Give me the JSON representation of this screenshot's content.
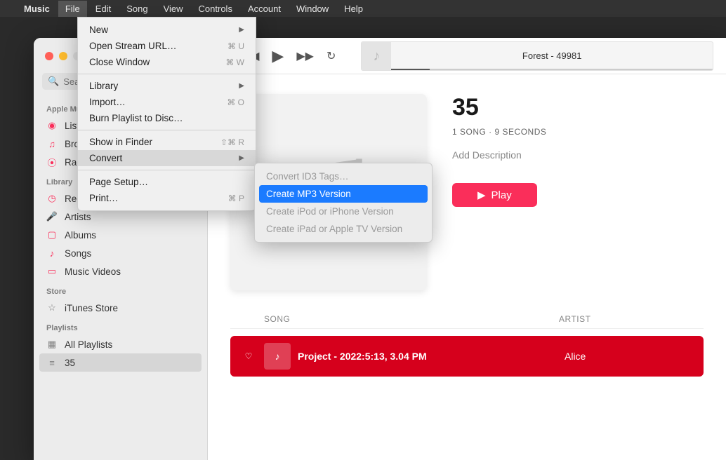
{
  "menubar": {
    "app": "Music",
    "items": [
      "File",
      "Edit",
      "Song",
      "View",
      "Controls",
      "Account",
      "Window",
      "Help"
    ],
    "active": "File"
  },
  "file_menu": {
    "items": [
      {
        "label": "New",
        "arrow": true
      },
      {
        "label": "Open Stream URL…",
        "shortcut": "⌘ U"
      },
      {
        "label": "Close Window",
        "shortcut": "⌘ W"
      },
      {
        "sep": true
      },
      {
        "label": "Library",
        "arrow": true
      },
      {
        "label": "Import…",
        "shortcut": "⌘ O"
      },
      {
        "label": "Burn Playlist to Disc…"
      },
      {
        "sep": true
      },
      {
        "label": "Show in Finder",
        "shortcut": "⇧⌘ R"
      },
      {
        "label": "Convert",
        "arrow": true,
        "hover": true
      },
      {
        "sep": true
      },
      {
        "label": "Page Setup…"
      },
      {
        "label": "Print…",
        "shortcut": "⌘ P"
      }
    ]
  },
  "convert_submenu": {
    "items": [
      {
        "label": "Convert ID3 Tags…",
        "enabled": false
      },
      {
        "label": "Create MP3 Version",
        "enabled": true,
        "highlighted": true
      },
      {
        "label": "Create iPod or iPhone Version",
        "enabled": false
      },
      {
        "label": "Create iPad or Apple TV Version",
        "enabled": false
      }
    ]
  },
  "sidebar": {
    "search_placeholder": "Search",
    "sections": [
      {
        "label": "Apple Music",
        "items": [
          {
            "icon": "play-circle",
            "label": "Listen Now"
          },
          {
            "icon": "music-note",
            "label": "Browse"
          },
          {
            "icon": "broadcast",
            "label": "Radio"
          }
        ]
      },
      {
        "label": "Library",
        "items": [
          {
            "icon": "clock",
            "label": "Recently Added"
          },
          {
            "icon": "mic",
            "label": "Artists"
          },
          {
            "icon": "album",
            "label": "Albums"
          },
          {
            "icon": "note",
            "label": "Songs"
          },
          {
            "icon": "video",
            "label": "Music Videos"
          }
        ]
      },
      {
        "label": "Store",
        "items": [
          {
            "icon": "star",
            "gray": true,
            "label": "iTunes Store"
          }
        ]
      },
      {
        "label": "Playlists",
        "items": [
          {
            "icon": "grid",
            "gray": true,
            "label": "All Playlists"
          },
          {
            "icon": "list",
            "gray": true,
            "label": "35",
            "active": true
          }
        ]
      }
    ]
  },
  "now_playing": {
    "title": "Forest - 49981"
  },
  "playlist": {
    "title": "35",
    "subtitle": "1 SONG · 9 SECONDS",
    "description": "Add Description",
    "play_label": "Play",
    "columns": {
      "song": "SONG",
      "artist": "ARTIST"
    },
    "tracks": [
      {
        "song": "Project - 2022:5:13, 3.04 PM",
        "artist": "Alice"
      }
    ]
  }
}
